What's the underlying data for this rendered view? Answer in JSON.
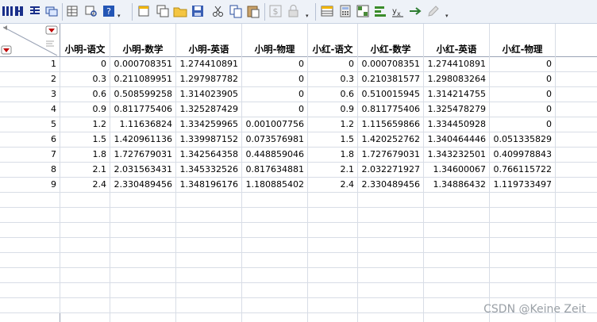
{
  "toolbar": {
    "buttons": [
      "column-layout-icon",
      "table-view-icon",
      "grid-icon",
      "windows-icon",
      "data-grid-icon",
      "search-data-icon",
      "help-icon",
      "new-table-icon",
      "copy-window-icon",
      "open-folder-icon",
      "save-icon",
      "cut-icon",
      "copy-icon",
      "paste-icon",
      "dollar-icon",
      "lock-icon",
      "table-icon",
      "calculator-icon",
      "grid-select-icon",
      "bar-chart-icon",
      "formula-icon",
      "arrow-right-icon",
      "pencil-icon"
    ]
  },
  "table": {
    "columns": [
      "小明-语文",
      "小明-数学",
      "小明-英语",
      "小明-物理",
      "小红-语文",
      "小红-数学",
      "小红-英语",
      "小红-物理"
    ],
    "rows": [
      {
        "n": "1",
        "v": [
          "0",
          "0.000708351",
          "1.274410891",
          "0",
          "0",
          "0.000708351",
          "1.274410891",
          "0"
        ]
      },
      {
        "n": "2",
        "v": [
          "0.3",
          "0.211089951",
          "1.297987782",
          "0",
          "0.3",
          "0.210381577",
          "1.298083264",
          "0"
        ]
      },
      {
        "n": "3",
        "v": [
          "0.6",
          "0.508599258",
          "1.314023905",
          "0",
          "0.6",
          "0.510015945",
          "1.314214755",
          "0"
        ]
      },
      {
        "n": "4",
        "v": [
          "0.9",
          "0.811775406",
          "1.325287429",
          "0",
          "0.9",
          "0.811775406",
          "1.325478279",
          "0"
        ]
      },
      {
        "n": "5",
        "v": [
          "1.2",
          "1.11636824",
          "1.334259965",
          "0.001007756",
          "1.2",
          "1.115659866",
          "1.334450928",
          "0"
        ]
      },
      {
        "n": "6",
        "v": [
          "1.5",
          "1.420961136",
          "1.339987152",
          "0.073576981",
          "1.5",
          "1.420252762",
          "1.340464446",
          "0.051335829"
        ]
      },
      {
        "n": "7",
        "v": [
          "1.8",
          "1.727679031",
          "1.342564358",
          "0.448859046",
          "1.8",
          "1.727679031",
          "1.343232501",
          "0.409978843"
        ]
      },
      {
        "n": "8",
        "v": [
          "2.1",
          "2.031563431",
          "1.345332526",
          "0.817634881",
          "2.1",
          "2.032271927",
          "1.34600067",
          "0.766115722"
        ]
      },
      {
        "n": "9",
        "v": [
          "2.4",
          "2.330489456",
          "1.348196176",
          "1.180885402",
          "2.4",
          "2.330489456",
          "1.34886432",
          "1.119733497"
        ]
      }
    ]
  },
  "watermark": "CSDN @Keine Zeit"
}
